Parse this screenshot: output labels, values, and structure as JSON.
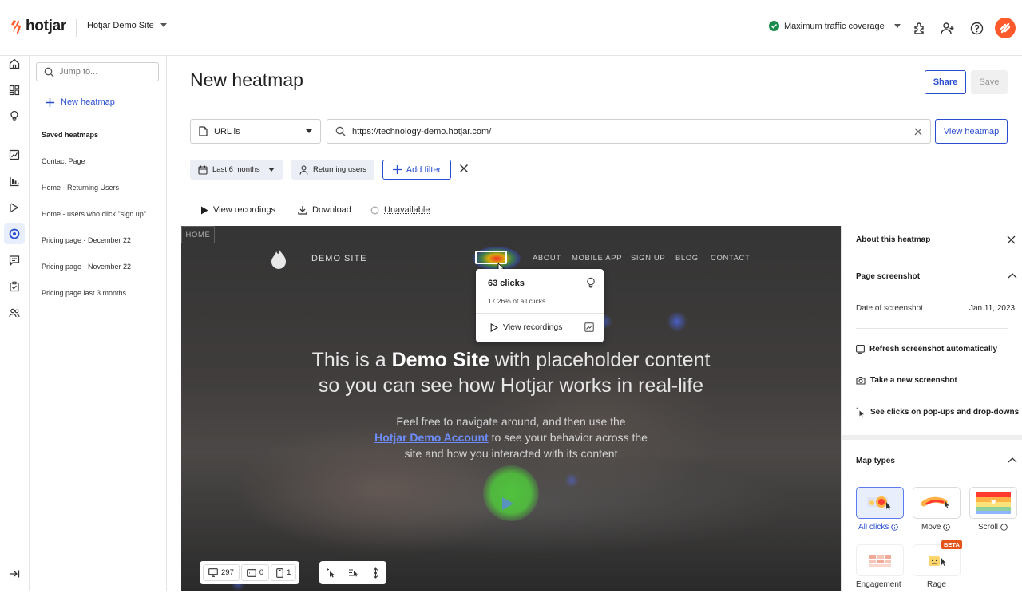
{
  "app": {
    "logo_text": "hotjar",
    "site_name": "Hotjar Demo Site",
    "coverage_label": "Maximum traffic coverage",
    "brand_color": "#ff5a2c",
    "accent_color": "#2a4dd0"
  },
  "sidebar": {
    "search_placeholder": "Jump to...",
    "new_heatmap_label": "New heatmap",
    "saved_title": "Saved heatmaps",
    "saved_items": [
      "Contact Page",
      "Home - Returning Users",
      "Home - users who click \"sign up\"",
      "Pricing page - December 22",
      "Pricing page - November 22",
      "Pricing page last 3 months"
    ]
  },
  "header": {
    "title": "New heatmap",
    "share_label": "Share",
    "save_label": "Save"
  },
  "url_filter": {
    "match_type": "URL is",
    "url": "https://technology-demo.hotjar.com/",
    "view_label": "View heatmap"
  },
  "filters": {
    "date_range": "Last 6 months",
    "segment": "Returning users",
    "add_filter_label": "Add filter"
  },
  "toolbar": {
    "view_recordings": "View recordings",
    "download": "Download",
    "unavailable": "Unavailable"
  },
  "preview": {
    "brand": "DEMO SITE",
    "nav": [
      "HOME",
      "ABOUT",
      "MOBILE APP",
      "SIGN UP",
      "BLOG",
      "CONTACT"
    ],
    "hero_line1_a": "This is a ",
    "hero_line1_b": "Demo Site",
    "hero_line1_c": " with placeholder content",
    "hero_line2": "so you can see how Hotjar works in real-life",
    "sub_line1": "Feel free to navigate around, and then use the",
    "sub_link": "Hotjar Demo Account",
    "sub_line2": " to see your behavior across the",
    "sub_line3": "site and how you interacted with its content",
    "popup": {
      "clicks": "63 clicks",
      "percent": "17.26% of all clicks",
      "view_recordings": "View recordings"
    },
    "device_counts": {
      "desktop": "297",
      "tablet": "0",
      "mobile": "1"
    }
  },
  "right_panel": {
    "title": "About this heatmap",
    "screenshot_section": "Page screenshot",
    "date_label": "Date of screenshot",
    "date_value": "Jan 11, 2023",
    "refresh_label": "Refresh screenshot automatically",
    "take_label": "Take a new screenshot",
    "popups_label": "See clicks on pop-ups and drop-downs",
    "map_types_section": "Map types",
    "map_types": [
      "All clicks",
      "Move",
      "Scroll",
      "Engagement",
      "Rage"
    ],
    "beta_badge": "BETA"
  }
}
